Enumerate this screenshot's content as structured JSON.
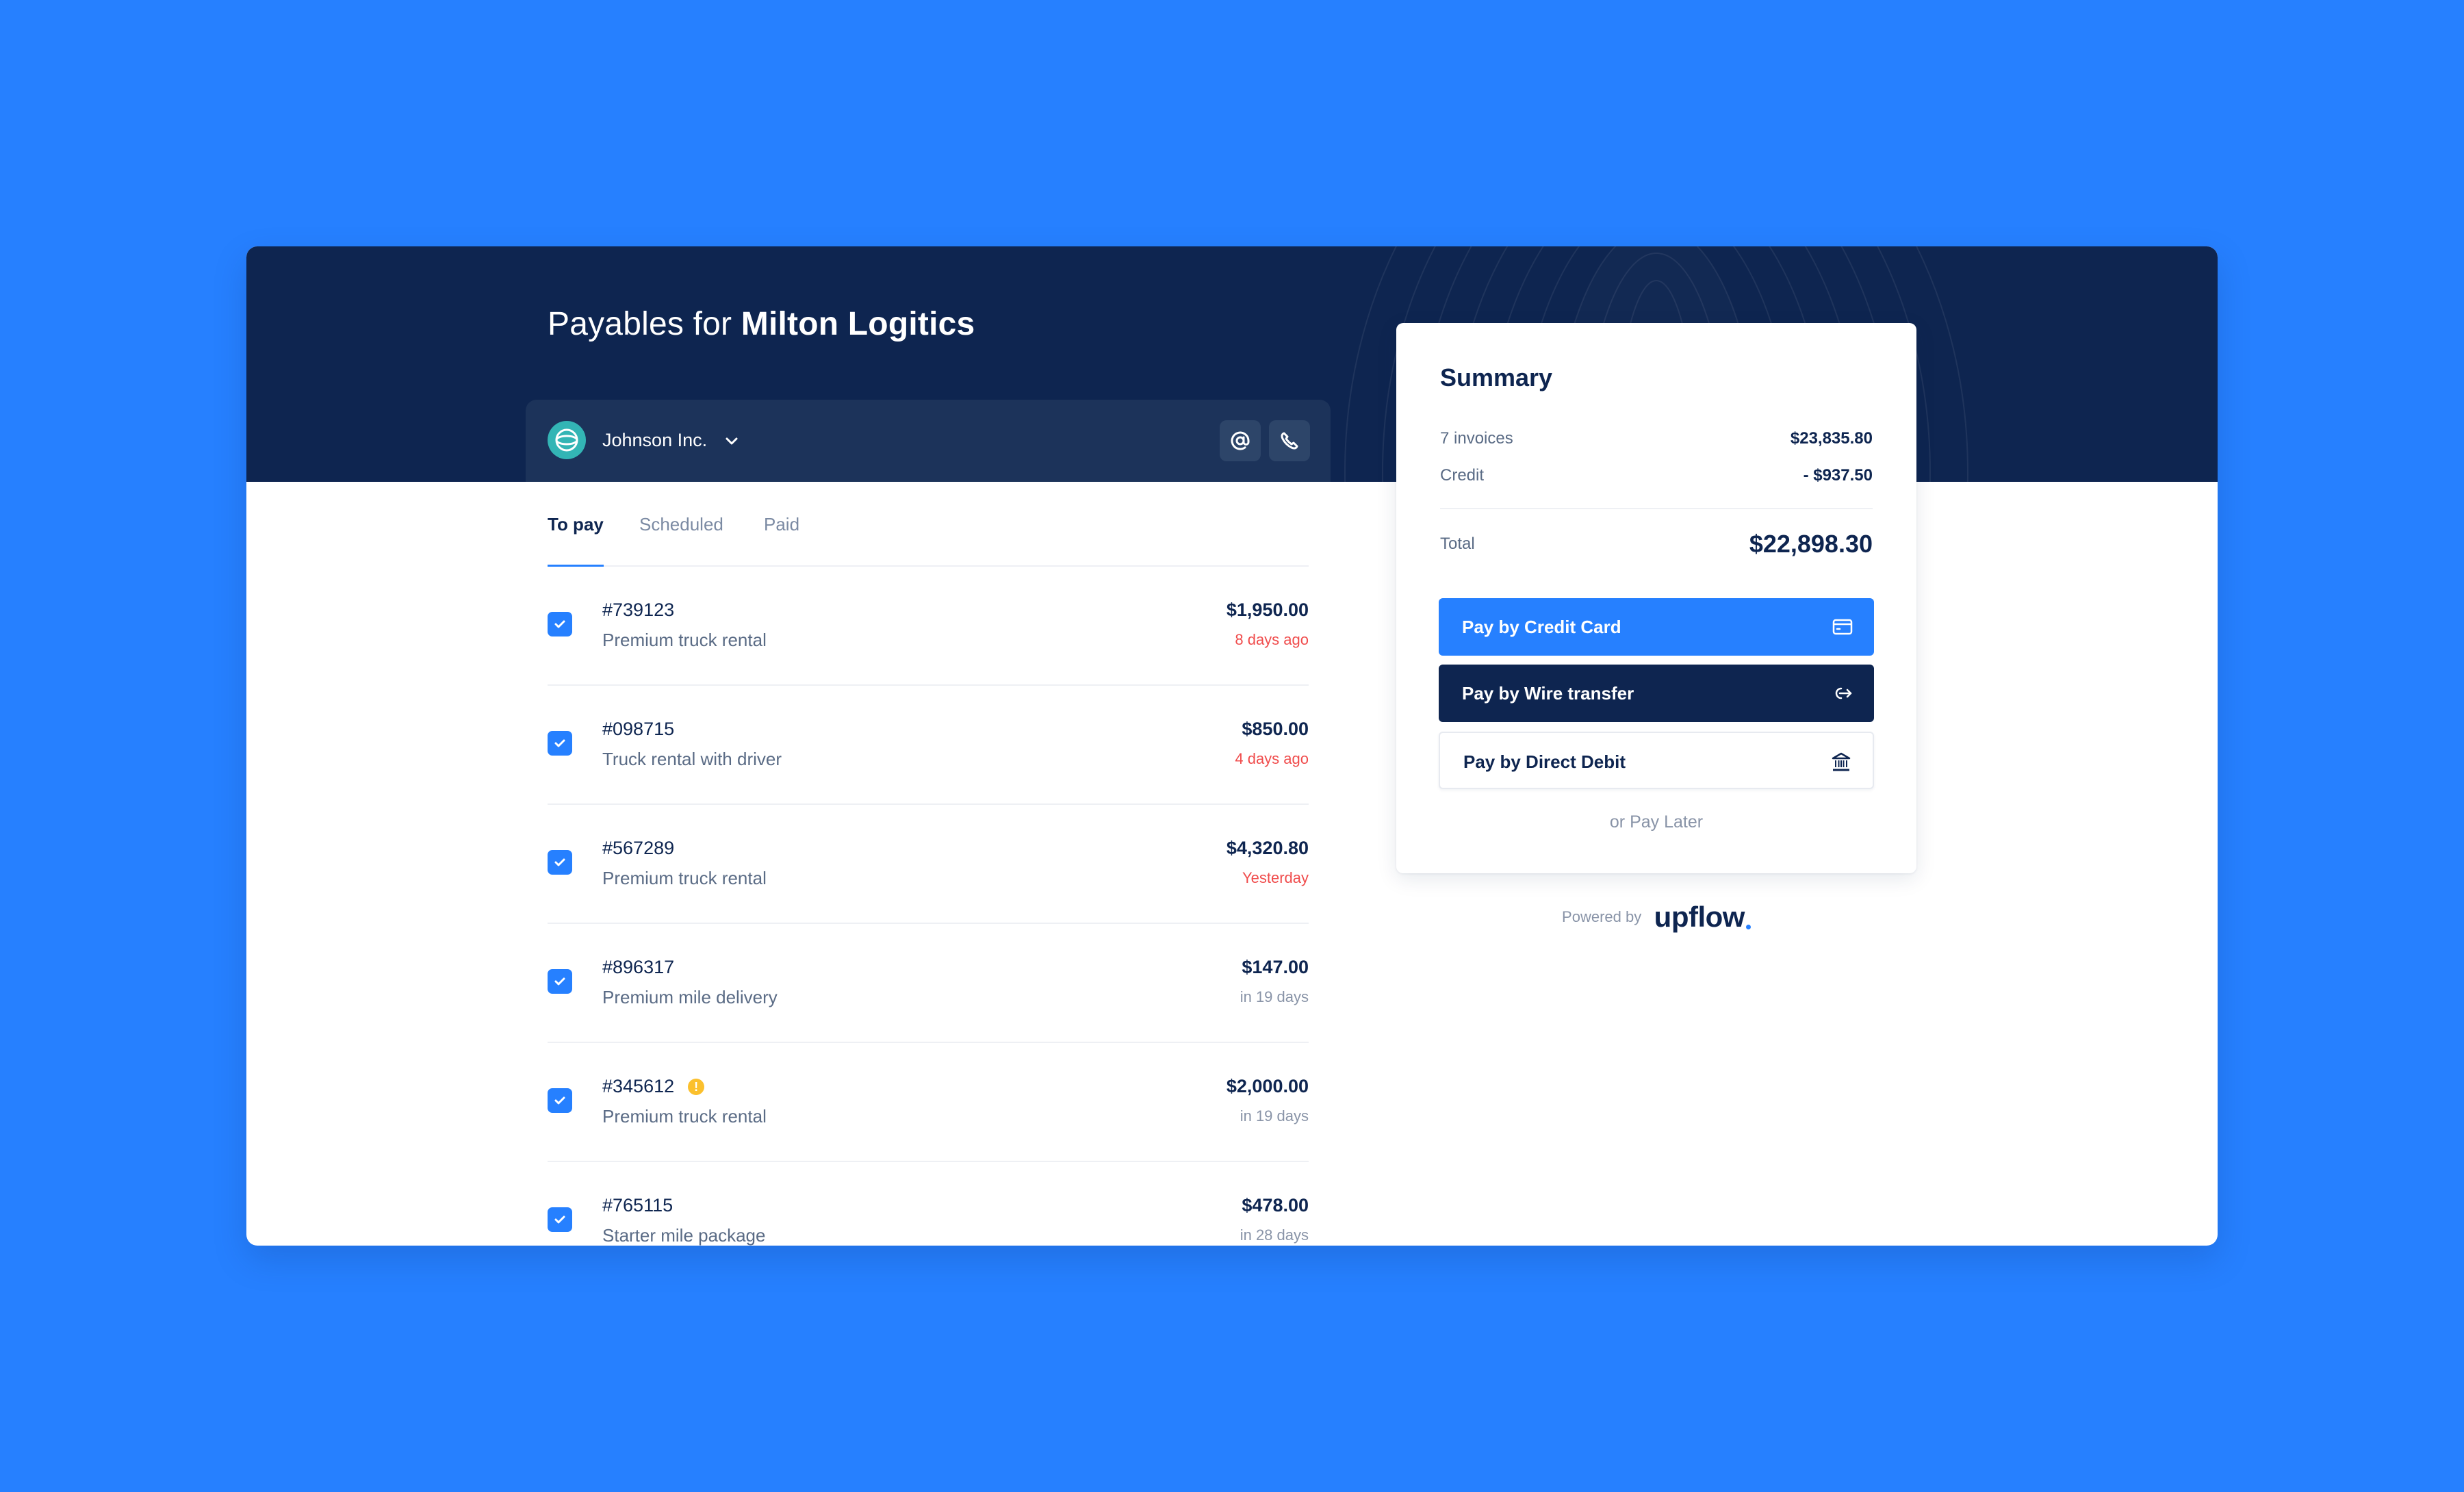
{
  "header": {
    "title_prefix": "Payables for",
    "company": "Milton Logitics"
  },
  "customer": {
    "name": "Johnson Inc.",
    "logo_icon": "globe-icon",
    "actions": [
      {
        "icon": "at-sign-icon",
        "label": "Email"
      },
      {
        "icon": "phone-icon",
        "label": "Call"
      }
    ]
  },
  "tabs": [
    {
      "label": "To pay",
      "active": true
    },
    {
      "label": "Scheduled",
      "active": false
    },
    {
      "label": "Paid",
      "active": false
    }
  ],
  "invoices": [
    {
      "number": "#739123",
      "description": "Premium truck rental",
      "amount": "$1,950.00",
      "due": "8 days ago",
      "overdue": true,
      "checked": true,
      "warning": false
    },
    {
      "number": "#098715",
      "description": "Truck rental with driver",
      "amount": "$850.00",
      "due": "4 days ago",
      "overdue": true,
      "checked": true,
      "warning": false
    },
    {
      "number": "#567289",
      "description": "Premium truck rental",
      "amount": "$4,320.80",
      "due": "Yesterday",
      "overdue": true,
      "checked": true,
      "warning": false
    },
    {
      "number": "#896317",
      "description": "Premium mile delivery",
      "amount": "$147.00",
      "due": "in 19 days",
      "overdue": false,
      "checked": true,
      "warning": false
    },
    {
      "number": "#345612",
      "description": "Premium truck rental",
      "amount": "$2,000.00",
      "due": "in 19 days",
      "overdue": false,
      "checked": true,
      "warning": true
    },
    {
      "number": "#765115",
      "description": "Starter mile package",
      "amount": "$478.00",
      "due": "in 28 days",
      "overdue": false,
      "checked": true,
      "warning": false
    }
  ],
  "summary": {
    "title": "Summary",
    "invoices_label": "7 invoices",
    "invoices_value": "$23,835.80",
    "credit_label": "Credit",
    "credit_value": "- $937.50",
    "total_label": "Total",
    "total_value": "$22,898.30"
  },
  "payment": {
    "credit_card": {
      "label": "Pay by Credit Card",
      "icon": "credit-card-icon"
    },
    "wire": {
      "label": "Pay by Wire transfer",
      "icon": "arrow-transfer-icon"
    },
    "direct_debit": {
      "label": "Pay by Direct Debit",
      "icon": "bank-icon"
    },
    "pay_later": "or Pay Later"
  },
  "footer": {
    "powered_by": "Powered by",
    "brand": "upflow"
  },
  "colors": {
    "background": "#2680FF",
    "header": "#0E2550",
    "accent": "#2680FF",
    "overdue": "#F04C4C",
    "warning": "#FBC02D",
    "logo": "#33B5B5"
  }
}
